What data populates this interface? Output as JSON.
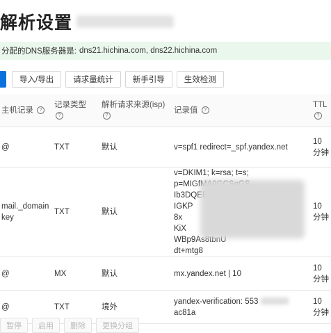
{
  "header": {
    "title": "解析设置"
  },
  "notice": {
    "label": "分配的DNS服务器是:",
    "servers": "dns21.hichina.com, dns22.hichina.com"
  },
  "toolbar": {
    "import_export": "导入/导出",
    "request_stats": "请求量统计",
    "guide": "新手引导",
    "check": "生效检测"
  },
  "table": {
    "headers": {
      "host": "主机记录",
      "type": "记录类型",
      "line": "解析请求来源(isp)",
      "value": "记录值",
      "ttl": "TTL"
    },
    "rows": [
      {
        "host": "@",
        "type": "TXT",
        "line": "默认",
        "value": "v=spf1 redirect=_spf.yandex.net",
        "ttl": "10 分钟"
      },
      {
        "host": "mail._domainkey",
        "type": "TXT",
        "line": "默认",
        "value_lines": [
          "v=DKIM1; k=rsa; t=s; p=MIGfMA0GCSqGS",
          "Ib3DQEB",
          "IGKP",
          "8x",
          "KiX",
          "WBp9As8tbnU",
          "dt+mtg8"
        ],
        "ttl": "10 分钟"
      },
      {
        "host": "@",
        "type": "MX",
        "line": "默认",
        "value": "mx.yandex.net | 10",
        "ttl": "10 分钟"
      },
      {
        "host": "@",
        "type": "TXT",
        "line": "境外",
        "value": "yandex-verification: 553",
        "value_tail": "ac81a",
        "ttl": "10 分钟"
      }
    ]
  },
  "footer": {
    "pause": "暂停",
    "enable": "启用",
    "delete": "删除",
    "change_group": "更换分组"
  }
}
